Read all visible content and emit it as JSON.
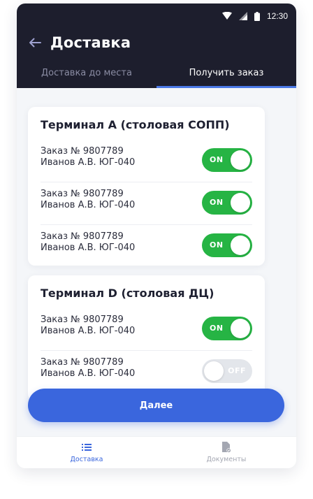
{
  "status_bar": {
    "time": "12:30"
  },
  "header": {
    "title": "Доставка",
    "tabs": [
      {
        "label": "Доставка до места",
        "active": false
      },
      {
        "label": "Получить заказ",
        "active": true
      }
    ]
  },
  "terminals": [
    {
      "title": "Терминал А (столовая СОПП)",
      "orders": [
        {
          "number": "Заказ № 9807789",
          "customer": "Иванов А.В. ЮГ-040",
          "toggle_label": "ON",
          "toggle_on": true
        },
        {
          "number": "Заказ № 9807789",
          "customer": "Иванов А.В. ЮГ-040",
          "toggle_label": "ON",
          "toggle_on": true
        },
        {
          "number": "Заказ № 9807789",
          "customer": "Иванов А.В. ЮГ-040",
          "toggle_label": "ON",
          "toggle_on": true
        }
      ]
    },
    {
      "title": "Терминал D (столовая ДЦ)",
      "orders": [
        {
          "number": "Заказ № 9807789",
          "customer": "Иванов А.В. ЮГ-040",
          "toggle_label": "ON",
          "toggle_on": true
        },
        {
          "number": "Заказ № 9807789",
          "customer": "Иванов А.В. ЮГ-040",
          "toggle_label": "OFF",
          "toggle_on": false
        }
      ]
    }
  ],
  "next_button": {
    "label": "Далее"
  },
  "bottom_nav": {
    "items": [
      {
        "label": "Доставка",
        "icon": "list-icon",
        "active": true
      },
      {
        "label": "Документы",
        "icon": "document-check-icon",
        "active": false
      }
    ]
  },
  "colors": {
    "header_bg": "#1d1e2d",
    "accent": "#3a66dd",
    "toggle_on": "#26b444",
    "toggle_off": "#e3e6eb"
  }
}
